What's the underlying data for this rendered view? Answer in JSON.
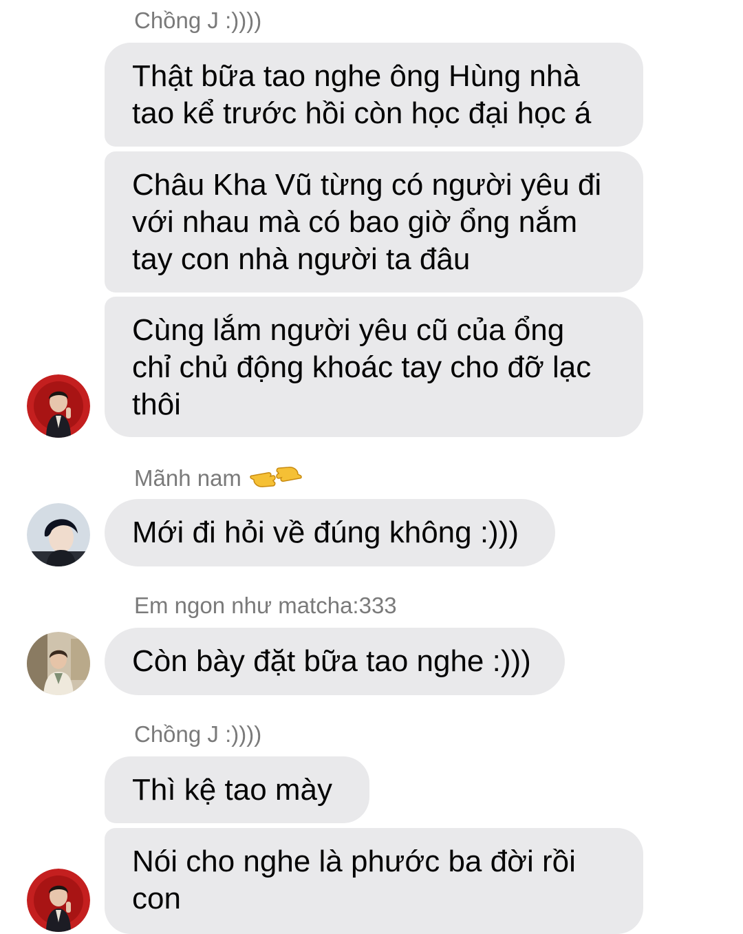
{
  "conversation": {
    "groups": [
      {
        "sender": "Chồng J :))))",
        "messages": [
          "Thật bữa tao nghe ông Hùng nhà\ntao kể trước hồi còn học đại học á",
          "Châu Kha Vũ từng có người yêu đi\nvới nhau mà có bao giờ ổng nắm\ntay con nhà người ta đâu",
          "Cùng lắm người yêu cũ của ổng\nchỉ chủ động khoác tay cho đỡ lạc\nthôi"
        ],
        "avatar": "avatar-red-background"
      },
      {
        "sender": "Mãnh nam",
        "sender_emoji": "pointing-hands-emoji",
        "messages": [
          "Mới đi hỏi về đúng không :)))"
        ],
        "avatar": "avatar-dark-hair"
      },
      {
        "sender": "Em ngon như matcha:333",
        "messages": [
          "Còn bày đặt bữa tao nghe :)))"
        ],
        "avatar": "avatar-light-outfit"
      },
      {
        "sender": "Chồng J :))))",
        "messages": [
          "Thì kệ tao mày",
          "Nói cho nghe là phước ba đời rồi\ncon"
        ],
        "avatar": "avatar-red-background"
      }
    ]
  },
  "colors": {
    "bubble": "#e9e9eb",
    "sender_name": "#7a7a7a",
    "text": "#050505",
    "background": "#ffffff"
  }
}
